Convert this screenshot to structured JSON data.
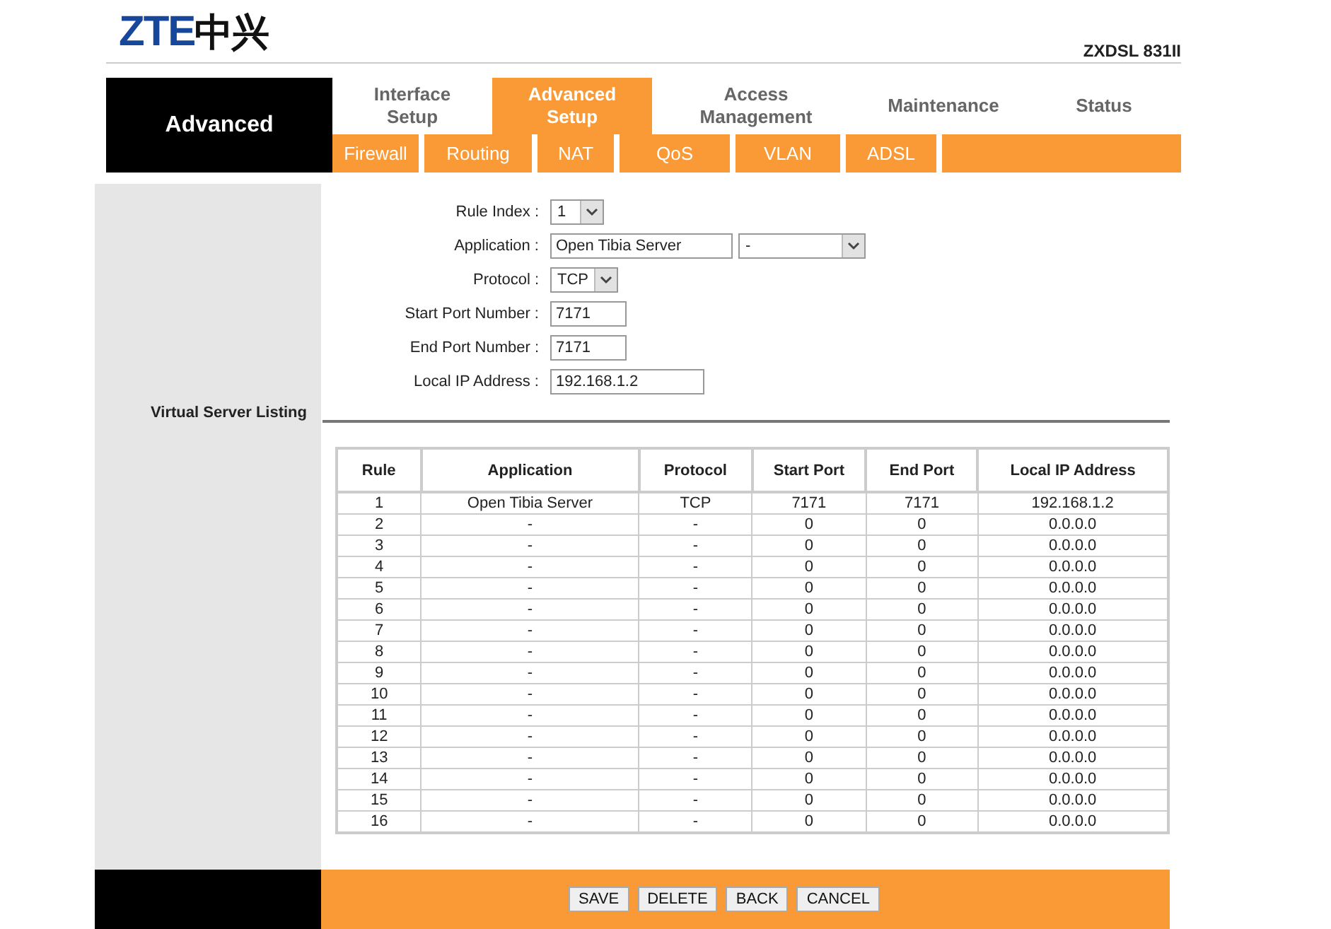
{
  "logo": {
    "brand": "ZTE",
    "brand_cn": "中兴"
  },
  "model": "ZXDSL 831II",
  "section": "Advanced",
  "tabs": [
    {
      "label": "Interface Setup",
      "selected": false
    },
    {
      "label": "Advanced Setup",
      "selected": true
    },
    {
      "label": "Access Management",
      "selected": false
    },
    {
      "label": "Maintenance",
      "selected": false
    },
    {
      "label": "Status",
      "selected": false
    }
  ],
  "subtabs": [
    "Firewall",
    "Routing",
    "NAT",
    "QoS",
    "VLAN",
    "ADSL"
  ],
  "form": [
    {
      "kind": "select",
      "label": "Rule Index :",
      "value": "1"
    },
    {
      "kind": "combo",
      "label": "Application :",
      "value": "Open Tibia Server",
      "select_value": "-"
    },
    {
      "kind": "select",
      "label": "Protocol :",
      "value": "TCP"
    },
    {
      "kind": "text",
      "label": "Start Port Number :",
      "value": "7171"
    },
    {
      "kind": "text",
      "label": "End Port Number :",
      "value": "7171"
    },
    {
      "kind": "wide",
      "label": "Local IP Address :",
      "value": "192.168.1.2"
    }
  ],
  "listing_title": "Virtual Server Listing",
  "table": {
    "columns": [
      "Rule",
      "Application",
      "Protocol",
      "Start Port",
      "End Port",
      "Local IP Address"
    ],
    "rows": [
      [
        "1",
        "Open Tibia Server",
        "TCP",
        "7171",
        "7171",
        "192.168.1.2"
      ],
      [
        "2",
        "-",
        "-",
        "0",
        "0",
        "0.0.0.0"
      ],
      [
        "3",
        "-",
        "-",
        "0",
        "0",
        "0.0.0.0"
      ],
      [
        "4",
        "-",
        "-",
        "0",
        "0",
        "0.0.0.0"
      ],
      [
        "5",
        "-",
        "-",
        "0",
        "0",
        "0.0.0.0"
      ],
      [
        "6",
        "-",
        "-",
        "0",
        "0",
        "0.0.0.0"
      ],
      [
        "7",
        "-",
        "-",
        "0",
        "0",
        "0.0.0.0"
      ],
      [
        "8",
        "-",
        "-",
        "0",
        "0",
        "0.0.0.0"
      ],
      [
        "9",
        "-",
        "-",
        "0",
        "0",
        "0.0.0.0"
      ],
      [
        "10",
        "-",
        "-",
        "0",
        "0",
        "0.0.0.0"
      ],
      [
        "11",
        "-",
        "-",
        "0",
        "0",
        "0.0.0.0"
      ],
      [
        "12",
        "-",
        "-",
        "0",
        "0",
        "0.0.0.0"
      ],
      [
        "13",
        "-",
        "-",
        "0",
        "0",
        "0.0.0.0"
      ],
      [
        "14",
        "-",
        "-",
        "0",
        "0",
        "0.0.0.0"
      ],
      [
        "15",
        "-",
        "-",
        "0",
        "0",
        "0.0.0.0"
      ],
      [
        "16",
        "-",
        "-",
        "0",
        "0",
        "0.0.0.0"
      ]
    ]
  },
  "buttons": [
    "SAVE",
    "DELETE",
    "BACK",
    "CANCEL"
  ]
}
